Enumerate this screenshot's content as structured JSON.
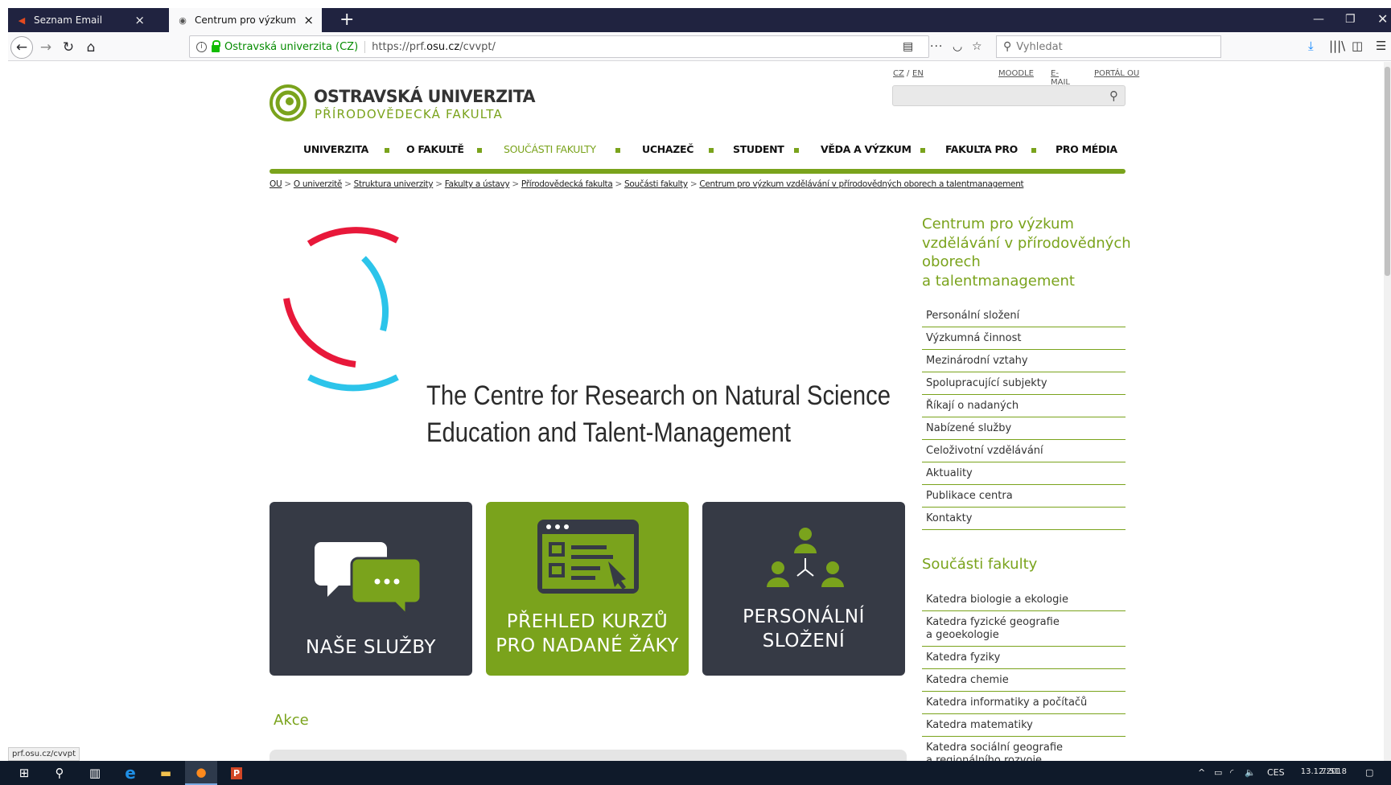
{
  "browser": {
    "tabs": [
      {
        "title": "Seznam Email",
        "favicon": "seznam-icon",
        "active": false
      },
      {
        "title": "Centrum pro výzkum vzdělávání",
        "favicon": "osu-icon",
        "active": true
      }
    ],
    "url_identity": "Ostravská univerzita (CZ)",
    "url_prefix": "https://prf.",
    "url_domain": "osu.cz",
    "url_path": "/cvvpt/",
    "search_placeholder": "Vyhledat",
    "status_url": "prf.osu.cz/cvvpt"
  },
  "site": {
    "lang_cz": "CZ",
    "lang_sep": "/",
    "lang_en": "EN",
    "links": {
      "moodle": "MOODLE",
      "email": "E-MAIL",
      "portal": "PORTÁL OU"
    },
    "logo_title": "OSTRAVSKÁ UNIVERZITA",
    "logo_sub": "PŘÍRODOVĚDECKÁ FAKULTA",
    "menu": [
      {
        "label": "UNIVERZITA",
        "active": false
      },
      {
        "label": "O FAKULTĚ",
        "active": false
      },
      {
        "label": "SOUČÁSTI FAKULTY",
        "active": true
      },
      {
        "label": "UCHAZEČ",
        "active": false
      },
      {
        "label": "STUDENT",
        "active": false
      },
      {
        "label": "VĚDA A VÝZKUM",
        "active": false
      },
      {
        "label": "FAKULTA PRO",
        "active": false
      },
      {
        "label": "PRO MÉDIA",
        "active": false
      }
    ],
    "breadcrumb": [
      "OU",
      "O univerzitě",
      "Struktura univerzity",
      "Fakulty a ústavy",
      "Přírodovědecká fakulta",
      "Součásti fakulty",
      "Centrum pro výzkum vzdělávání v přírodovědných oborech a talentmanagement"
    ],
    "breadcrumb_sep": ">",
    "hero_line1": "The Centre for Research on Natural Science",
    "hero_line2": "Education and Talent-Management",
    "tiles": [
      {
        "line1": "NAŠE SLUŽBY",
        "line2": ""
      },
      {
        "line1": "PŘEHLED KURZŮ",
        "line2": "PRO NADANÉ ŽÁKY"
      },
      {
        "line1": "PERSONÁLNÍ",
        "line2": "SLOŽENÍ"
      }
    ],
    "section_akce": "Akce",
    "sidebar_title": [
      "Centrum pro výzkum",
      "vzdělávání v přírodovědných",
      "oborech",
      "a talentmanagement"
    ],
    "sidebar_items": [
      "Personální složení",
      "Výzkumná činnost",
      "Mezinárodní vztahy",
      "Spolupracující subjekty",
      "Říkají o nadaných",
      "Nabízené služby",
      "Celoživotní vzdělávání",
      "Aktuality",
      "Publikace centra",
      "Kontakty"
    ],
    "sidebar_title2": "Součásti fakulty",
    "faculty_items": [
      [
        "Katedra biologie a ekologie"
      ],
      [
        "Katedra fyzické geografie",
        "a geoekologie"
      ],
      [
        "Katedra fyziky"
      ],
      [
        "Katedra chemie"
      ],
      [
        "Katedra informatiky a počítačů"
      ],
      [
        "Katedra matematiky"
      ],
      [
        "Katedra sociální geografie",
        "a regionálního rozvoje"
      ]
    ],
    "colors": {
      "brand_green": "#7aa31c",
      "tile_dark": "#363a45",
      "ring_red": "#e8183a",
      "ring_blue": "#2cc4ea"
    }
  },
  "taskbar": {
    "lang": "CES",
    "time": "7:51",
    "date": "13.12.2018"
  }
}
